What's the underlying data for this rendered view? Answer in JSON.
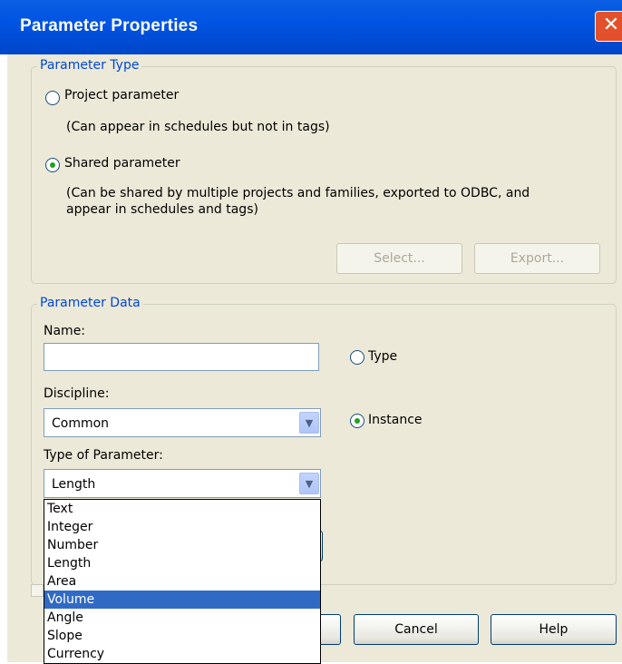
{
  "window": {
    "title": "Parameter Properties"
  },
  "parameter_type": {
    "legend": "Parameter Type",
    "project": {
      "label": "Project parameter",
      "selected": false
    },
    "project_note": "(Can appear in schedules but not in tags)",
    "shared": {
      "label": "Shared parameter",
      "selected": true
    },
    "shared_note_line1": "(Can be shared by multiple projects and families, exported to ODBC, and",
    "shared_note_line2": "appear in schedules and tags)",
    "select_button": "Select...",
    "export_button": "Export..."
  },
  "parameter_data": {
    "legend": "Parameter Data",
    "name_label": "Name:",
    "name_value": "",
    "discipline_label": "Discipline:",
    "discipline_value": "Common",
    "type_of_parameter_label": "Type of Parameter:",
    "type_of_parameter_value": "Length",
    "type_radio": {
      "label": "Type",
      "selected": false
    },
    "instance_radio": {
      "label": "Instance",
      "selected": true
    }
  },
  "dropdown_options": [
    "Text",
    "Integer",
    "Number",
    "Length",
    "Area",
    "Volume",
    "Angle",
    "Slope",
    "Currency"
  ],
  "dropdown_highlighted": "Volume",
  "footer": {
    "cancel_button": "Cancel",
    "help_button": "Help"
  },
  "colors": {
    "title_bar": "#0054e3",
    "dialog_bg": "#ece9d8",
    "group_label": "#0046d5",
    "selection": "#316ac5"
  }
}
